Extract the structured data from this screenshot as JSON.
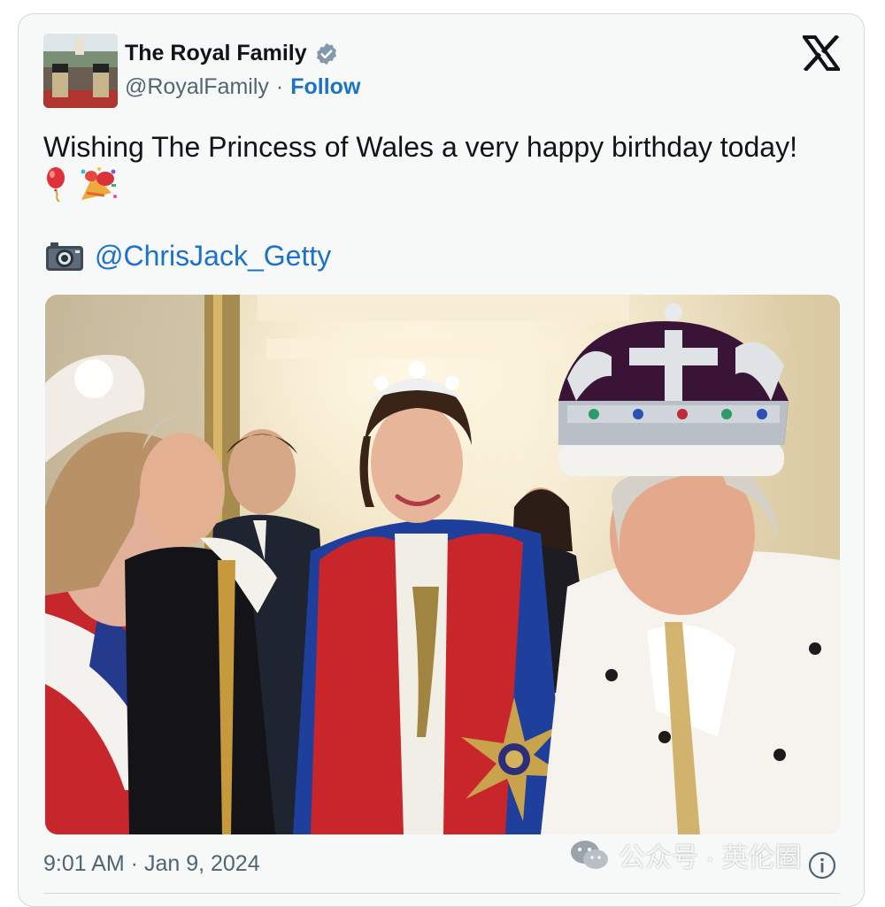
{
  "tweet": {
    "display_name": "The Royal Family",
    "handle": "@RoyalFamily",
    "separator": "·",
    "follow_label": "Follow",
    "text": "Wishing The Princess of Wales a very happy birthday today!",
    "emoji_1": "balloon-emoji",
    "emoji_2": "confetti-emoji",
    "camera_icon": "camera-icon",
    "photo_credit": "@ChrisJack_Getty",
    "timestamp": "9:01 AM · Jan 9, 2024"
  },
  "watermark": {
    "icon": "wechat-icon",
    "text": "公众号 · 英伦圈"
  },
  "colors": {
    "link": "#1d72c8",
    "verified": "#829aab",
    "secondary_text": "#536471",
    "card_bg": "#f7f9f9",
    "border": "#cfd9de"
  }
}
